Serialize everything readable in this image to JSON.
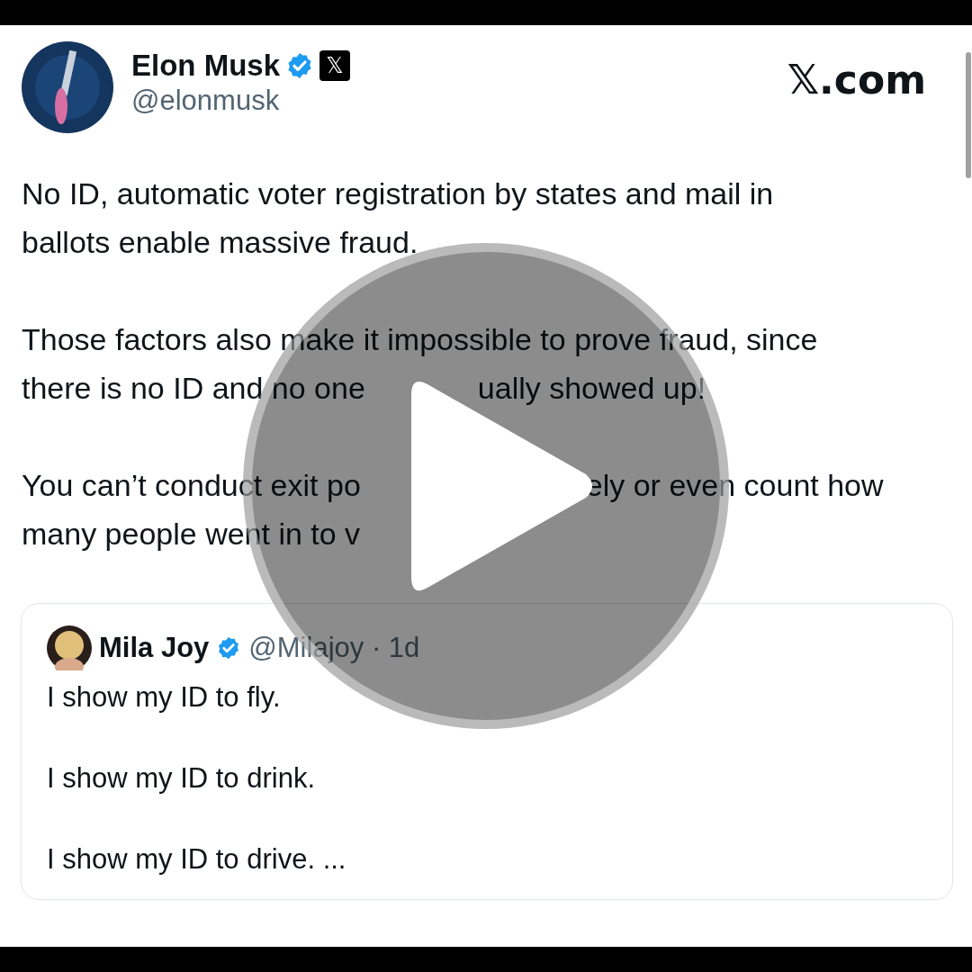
{
  "author": {
    "name": "Elon Musk",
    "handle": "@elonmusk",
    "verified": true,
    "affiliate_badge": "𝕏"
  },
  "site_label": "𝕏.com",
  "paragraphs": [
    [
      [
        "No ID, automatic voter registration by states and mail in"
      ],
      [
        "ballots enable massive fraud."
      ]
    ],
    [
      [
        "Those factors also make it impossible to prove fraud, since"
      ],
      [
        "there is no ID and no one",
        "ually showed up!"
      ]
    ],
    [
      [
        "You can’t conduct exit po",
        "ely or even count how"
      ],
      [
        "many people went in to v"
      ]
    ]
  ],
  "quoted_post": {
    "name": "Mila Joy",
    "verified": true,
    "handle_time": "@Milajoy · 1d",
    "paragraphs": [
      "I show my ID to fly.",
      "I show my ID to drink.",
      "I show my ID to drive. ..."
    ]
  }
}
